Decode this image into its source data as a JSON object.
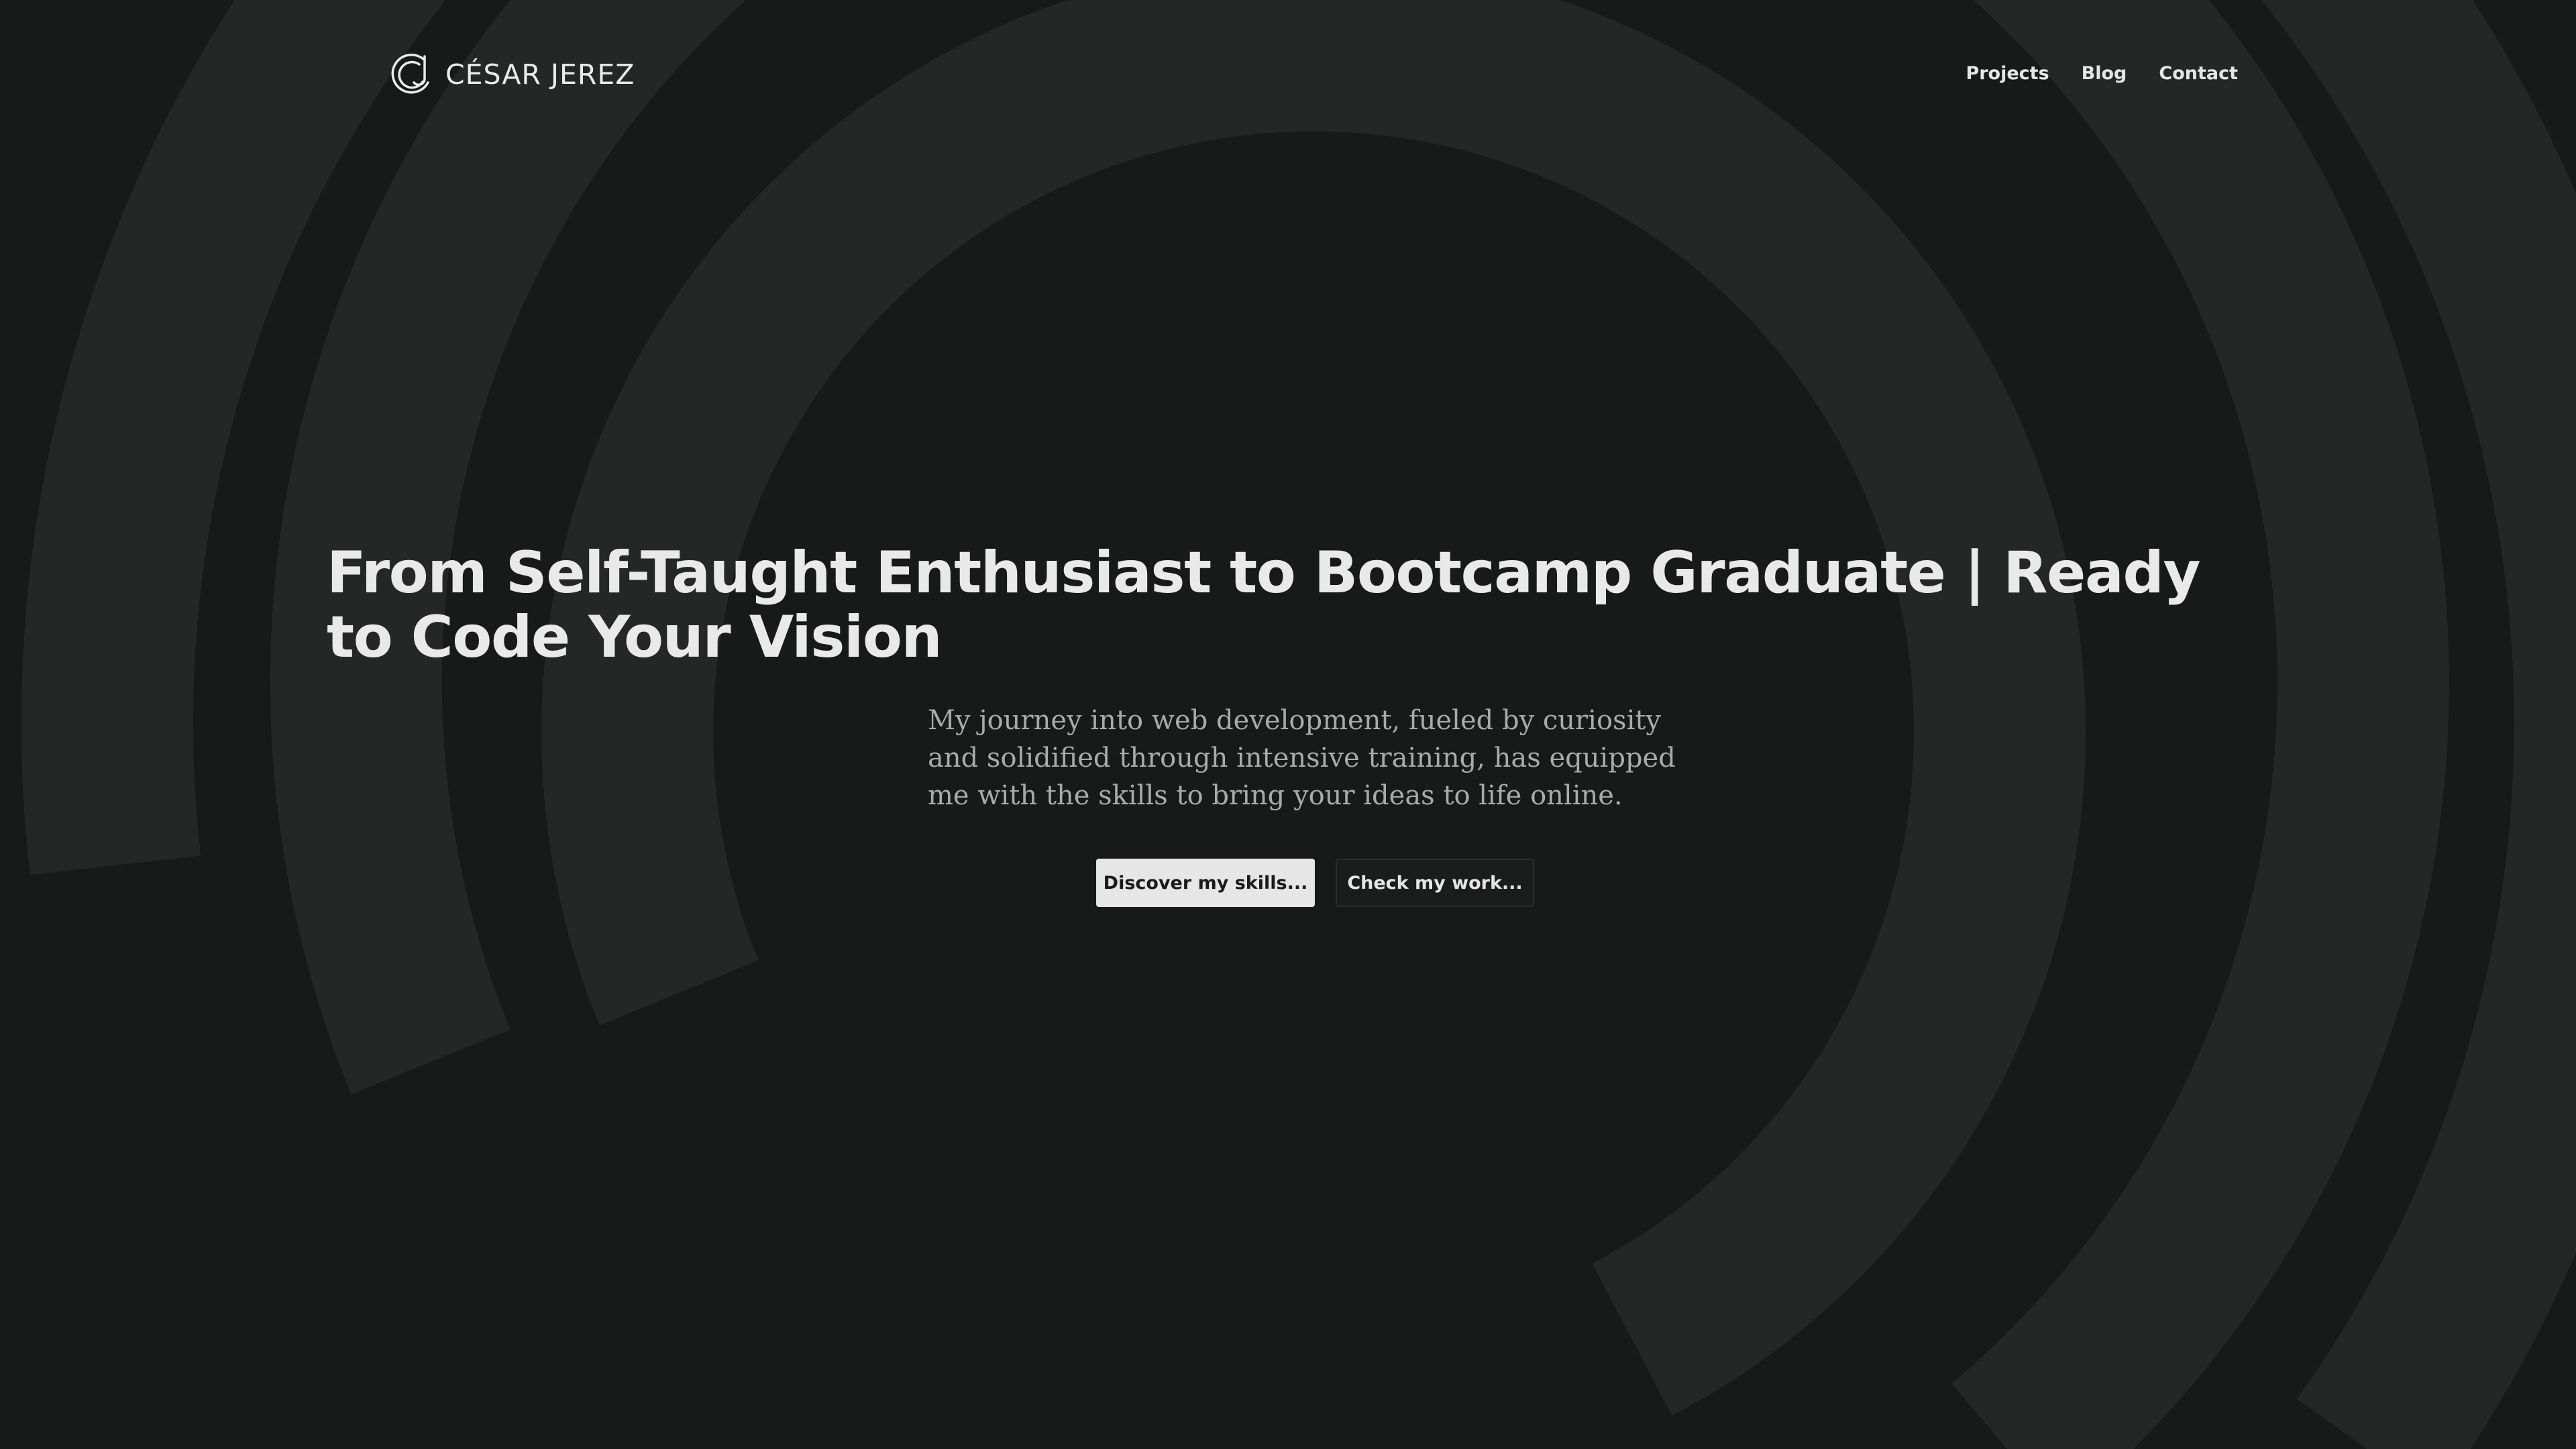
{
  "brand": {
    "name": "CÉSAR JEREZ",
    "logo_icon": "cj-monogram-icon"
  },
  "nav": {
    "items": [
      {
        "label": "Projects"
      },
      {
        "label": "Blog"
      },
      {
        "label": "Contact"
      }
    ]
  },
  "hero": {
    "title": "From Self-Taught Enthusiast to Bootcamp Graduate | Ready to Code Your Vision",
    "description": "My journey into web development, fueled by curiosity and solidified through intensive training, has equipped me with the skills to bring your ideas to life online.",
    "primary_cta": "Discover my skills...",
    "secondary_cta": "Check my work..."
  },
  "colors": {
    "background": "#181a1a",
    "background_art": "#252727",
    "text_primary": "#e9e9e9",
    "text_secondary": "#a9aaaa",
    "button_primary_bg": "#e6e6e6",
    "button_secondary_border": "#2c2e2e"
  }
}
